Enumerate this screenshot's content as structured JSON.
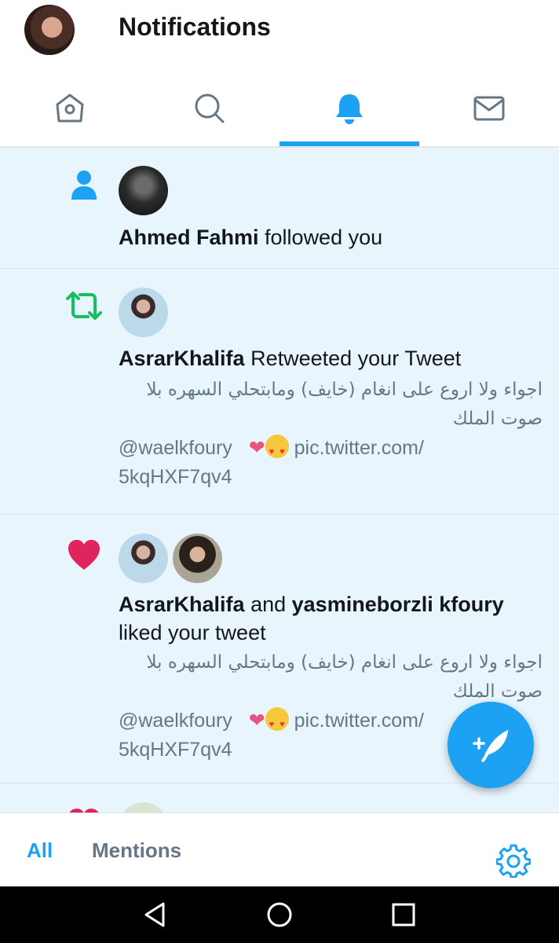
{
  "header": {
    "title": "Notifications",
    "avatar": "profile-avatar"
  },
  "nav": {
    "tabs": [
      {
        "name": "home",
        "icon": "home-icon"
      },
      {
        "name": "search",
        "icon": "search-icon"
      },
      {
        "name": "notifications",
        "icon": "bell-icon",
        "active": true
      },
      {
        "name": "messages",
        "icon": "mail-icon"
      }
    ]
  },
  "notifications": [
    {
      "type": "follow",
      "icon": "person-icon",
      "user": "Ahmed Fahmi",
      "action": " followed you"
    },
    {
      "type": "retweet",
      "icon": "retweet-icon",
      "user": "AsrarKhalifa",
      "action": " Retweeted your Tweet",
      "tweet_ar": "اجواء ولا اروع على انغام (خايف) ومابتحلي السهره بلا صوت الملك",
      "tweet_handle": "@waelkfoury",
      "tweet_link": "pic.twitter.com/",
      "tweet_link2": "5kqHXF7qv4"
    },
    {
      "type": "like",
      "icon": "heart-icon",
      "user": "AsrarKhalifa",
      "joiner": " and ",
      "user2": "yasmineborzli kfoury",
      "action": "liked your tweet",
      "tweet_ar": "اجواء ولا اروع على انغام (خايف) ومابتحلي السهره بلا صوت الملك",
      "tweet_handle": "@waelkfoury",
      "tweet_link": "pic.twitter.com/",
      "tweet_link2": "5kqHXF7qv4"
    }
  ],
  "filters": {
    "all": "All",
    "mentions": "Mentions"
  },
  "colors": {
    "accent": "#1da1f2",
    "retweet": "#17bf63",
    "like": "#e0245e",
    "feed_bg": "#e8f5fd"
  }
}
